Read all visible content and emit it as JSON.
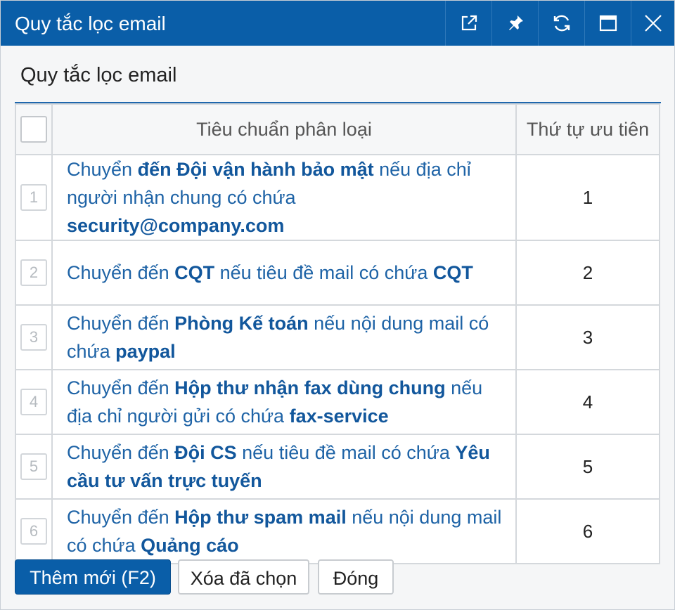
{
  "window": {
    "title": "Quy tắc lọc email",
    "buttons": [
      {
        "name": "open-external",
        "icon": "external-link-icon"
      },
      {
        "name": "pin",
        "icon": "pin-icon"
      },
      {
        "name": "refresh",
        "icon": "refresh-icon"
      },
      {
        "name": "maximize",
        "icon": "maximize-icon"
      },
      {
        "name": "close",
        "icon": "close-icon"
      }
    ]
  },
  "section": {
    "title": "Quy tắc lọc email"
  },
  "table": {
    "columns": {
      "criteria": "Tiêu chuẩn phân loại",
      "priority": "Thứ tự ưu tiên"
    },
    "rows": [
      {
        "num": "1",
        "priority": "1",
        "criteria": [
          {
            "t": "Chuyển ",
            "b": false
          },
          {
            "t": "đến Đội vận hành bảo mật",
            "b": true
          },
          {
            "t": " nếu địa chỉ người nhận chung có chứa ",
            "b": false
          },
          {
            "t": "security@company.com",
            "b": true
          }
        ]
      },
      {
        "num": "2",
        "priority": "2",
        "criteria": [
          {
            "t": "Chuyển đến ",
            "b": false
          },
          {
            "t": "CQT",
            "b": true
          },
          {
            "t": " nếu tiêu đề mail có chứa ",
            "b": false
          },
          {
            "t": "CQT",
            "b": true
          }
        ]
      },
      {
        "num": "3",
        "priority": "3",
        "criteria": [
          {
            "t": "Chuyển đến ",
            "b": false
          },
          {
            "t": "Phòng Kế toán",
            "b": true
          },
          {
            "t": " nếu nội dung mail có chứa ",
            "b": false
          },
          {
            "t": "paypal",
            "b": true
          }
        ]
      },
      {
        "num": "4",
        "priority": "4",
        "criteria": [
          {
            "t": "Chuyển đến ",
            "b": false
          },
          {
            "t": "Hộp thư nhận fax dùng chung",
            "b": true
          },
          {
            "t": " nếu địa chỉ người gửi có chứa ",
            "b": false
          },
          {
            "t": "fax-service",
            "b": true
          }
        ]
      },
      {
        "num": "5",
        "priority": "5",
        "criteria": [
          {
            "t": "Chuyển đến ",
            "b": false
          },
          {
            "t": "Đội CS",
            "b": true
          },
          {
            "t": " nếu tiêu đề mail có chứa ",
            "b": false
          },
          {
            "t": "Yêu cầu tư vấn trực tuyến",
            "b": true
          }
        ]
      },
      {
        "num": "6",
        "priority": "6",
        "criteria": [
          {
            "t": "Chuyển đến ",
            "b": false
          },
          {
            "t": "Hộp thư spam mail",
            "b": true
          },
          {
            "t": " nếu nội dung mail có chứa ",
            "b": false
          },
          {
            "t": "Quảng cáo",
            "b": true
          }
        ]
      }
    ]
  },
  "footer": {
    "add_label": "Thêm mới (F2)",
    "delete_label": "Xóa đã chọn",
    "close_label": "Đóng"
  },
  "colors": {
    "accent": "#0a5ea8",
    "link": "#1e63a6"
  }
}
